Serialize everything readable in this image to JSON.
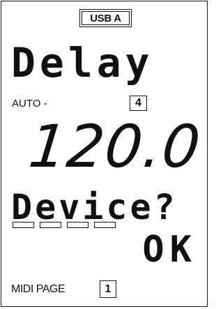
{
  "header": {
    "port_label": "USB A"
  },
  "parameter": {
    "name": "Delay"
  },
  "mode": {
    "label": "AUTO -",
    "slot": "4"
  },
  "value": {
    "display": "120.0"
  },
  "prompt": {
    "text": "Device?",
    "indicator_count": 4
  },
  "confirm": {
    "label": "OK"
  },
  "footer": {
    "page_label": "MIDI PAGE",
    "page_number": "1"
  }
}
